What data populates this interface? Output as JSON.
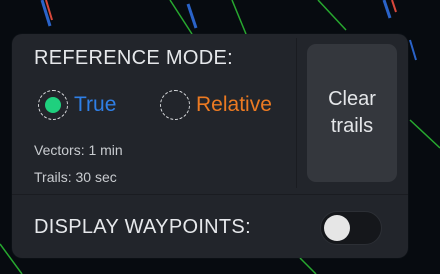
{
  "reference_mode": {
    "title": "REFERENCE MODE:",
    "options": [
      {
        "label": "True",
        "selected": true,
        "color": "#2f7fe6"
      },
      {
        "label": "Relative",
        "selected": false,
        "color": "#ec7a22"
      }
    ],
    "selected_indicator_color": "#1fd07e",
    "vectors_text": "Vectors: 1 min",
    "trails_text": "Trails: 30 sec"
  },
  "clear_trails_button": {
    "line1": "Clear",
    "line2": "trails"
  },
  "display_waypoints": {
    "label": "DISPLAY WAYPOINTS:",
    "enabled": false
  }
}
